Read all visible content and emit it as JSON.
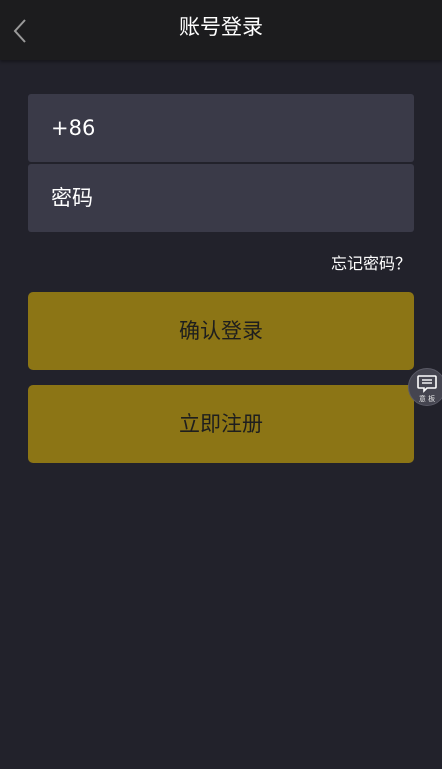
{
  "header": {
    "title": "账号登录",
    "back_icon": "chevron-left-icon"
  },
  "form": {
    "phone_value": "+86",
    "password_placeholder": "密码",
    "forgot_link": "忘记密码？"
  },
  "actions": {
    "login_label": "确认登录",
    "register_label": "立即注册"
  },
  "floating": {
    "icon": "message-icon",
    "label": "意 板"
  },
  "colors": {
    "background": "#22222b",
    "header": "#1c1c1e",
    "field": "#3a3a48",
    "button": "#8c7515"
  }
}
